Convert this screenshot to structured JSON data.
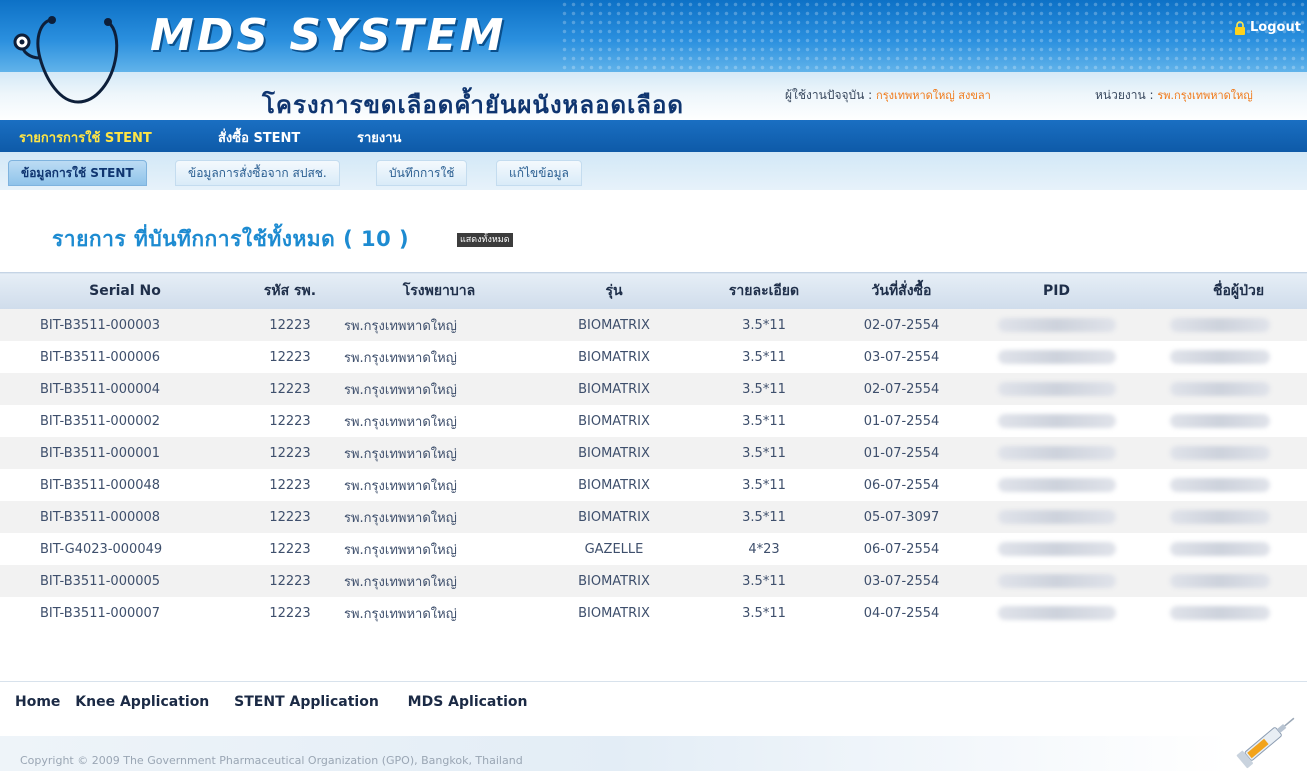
{
  "header": {
    "system_title": "MDS SYSTEM",
    "project_title": "โครงการขดเลือดค้ำยันผนังหลอดเลือด",
    "logout_label": "Logout",
    "user_label": "ผู้ใช้งานปัจจุบัน :",
    "user_value": "กรุงเทพหาดใหญ่ สงขลา",
    "unit_label": "หน่วยงาน :",
    "unit_value": "รพ.กรุงเทพหาดใหญ่"
  },
  "main_menu": [
    {
      "label": "รายการการใช้ STENT",
      "active": true
    },
    {
      "label": "สั่งซื้อ STENT",
      "active": false
    },
    {
      "label": "รายงาน",
      "active": false
    }
  ],
  "sub_menu": [
    {
      "label": "ข้อมูลการใช้ STENT",
      "active": true
    },
    {
      "label": "ข้อมูลการสั่งซื้อจาก สปสช.",
      "active": false
    },
    {
      "label": "บันทึกการใช้",
      "active": false
    },
    {
      "label": "แก้ไขข้อมูล",
      "active": false
    }
  ],
  "page": {
    "heading": "รายการ  ที่บันทึกการใช้ทั้งหมด ( 10 )",
    "show_all_label": "แสดงทั้งหมด"
  },
  "table": {
    "columns": [
      "Serial No",
      "รหัส รพ.",
      "โรงพยาบาล",
      "รุ่น",
      "รายละเอียด",
      "วันที่สั่งซื้อ",
      "PID",
      "ชื่อผู้ป่วย"
    ],
    "rows": [
      {
        "serial": "BIT-B3511-000003",
        "code": "12223",
        "hospital": "รพ.กรุงเทพหาดใหญ่",
        "model": "BIOMATRIX",
        "detail": "3.5*11",
        "date": "02-07-2554"
      },
      {
        "serial": "BIT-B3511-000006",
        "code": "12223",
        "hospital": "รพ.กรุงเทพหาดใหญ่",
        "model": "BIOMATRIX",
        "detail": "3.5*11",
        "date": "03-07-2554"
      },
      {
        "serial": "BIT-B3511-000004",
        "code": "12223",
        "hospital": "รพ.กรุงเทพหาดใหญ่",
        "model": "BIOMATRIX",
        "detail": "3.5*11",
        "date": "02-07-2554"
      },
      {
        "serial": "BIT-B3511-000002",
        "code": "12223",
        "hospital": "รพ.กรุงเทพหาดใหญ่",
        "model": "BIOMATRIX",
        "detail": "3.5*11",
        "date": "01-07-2554"
      },
      {
        "serial": "BIT-B3511-000001",
        "code": "12223",
        "hospital": "รพ.กรุงเทพหาดใหญ่",
        "model": "BIOMATRIX",
        "detail": "3.5*11",
        "date": "01-07-2554"
      },
      {
        "serial": "BIT-B3511-000048",
        "code": "12223",
        "hospital": "รพ.กรุงเทพหาดใหญ่",
        "model": "BIOMATRIX",
        "detail": "3.5*11",
        "date": "06-07-2554"
      },
      {
        "serial": "BIT-B3511-000008",
        "code": "12223",
        "hospital": "รพ.กรุงเทพหาดใหญ่",
        "model": "BIOMATRIX",
        "detail": "3.5*11",
        "date": "05-07-3097"
      },
      {
        "serial": "BIT-G4023-000049",
        "code": "12223",
        "hospital": "รพ.กรุงเทพหาดใหญ่",
        "model": "GAZELLE",
        "detail": "4*23",
        "date": "06-07-2554"
      },
      {
        "serial": "BIT-B3511-000005",
        "code": "12223",
        "hospital": "รพ.กรุงเทพหาดใหญ่",
        "model": "BIOMATRIX",
        "detail": "3.5*11",
        "date": "03-07-2554"
      },
      {
        "serial": "BIT-B3511-000007",
        "code": "12223",
        "hospital": "รพ.กรุงเทพหาดใหญ่",
        "model": "BIOMATRIX",
        "detail": "3.5*11",
        "date": "04-07-2554"
      }
    ]
  },
  "footer": {
    "nav": [
      "Home",
      "Knee Application",
      "STENT Application",
      "MDS Aplication"
    ],
    "copyright": "Copyright © 2009 The Government Pharmaceutical Organization (GPO), Bangkok, Thailand"
  },
  "icons": {
    "logo": "stethoscope-icon",
    "logout": "lock-icon",
    "footer_art": "syringe-icon"
  },
  "colors": {
    "menu_bar": "#0e5aa8",
    "menu_active_text": "#ffe545",
    "heading": "#1d8bd1",
    "info_value": "#f07a1a"
  }
}
